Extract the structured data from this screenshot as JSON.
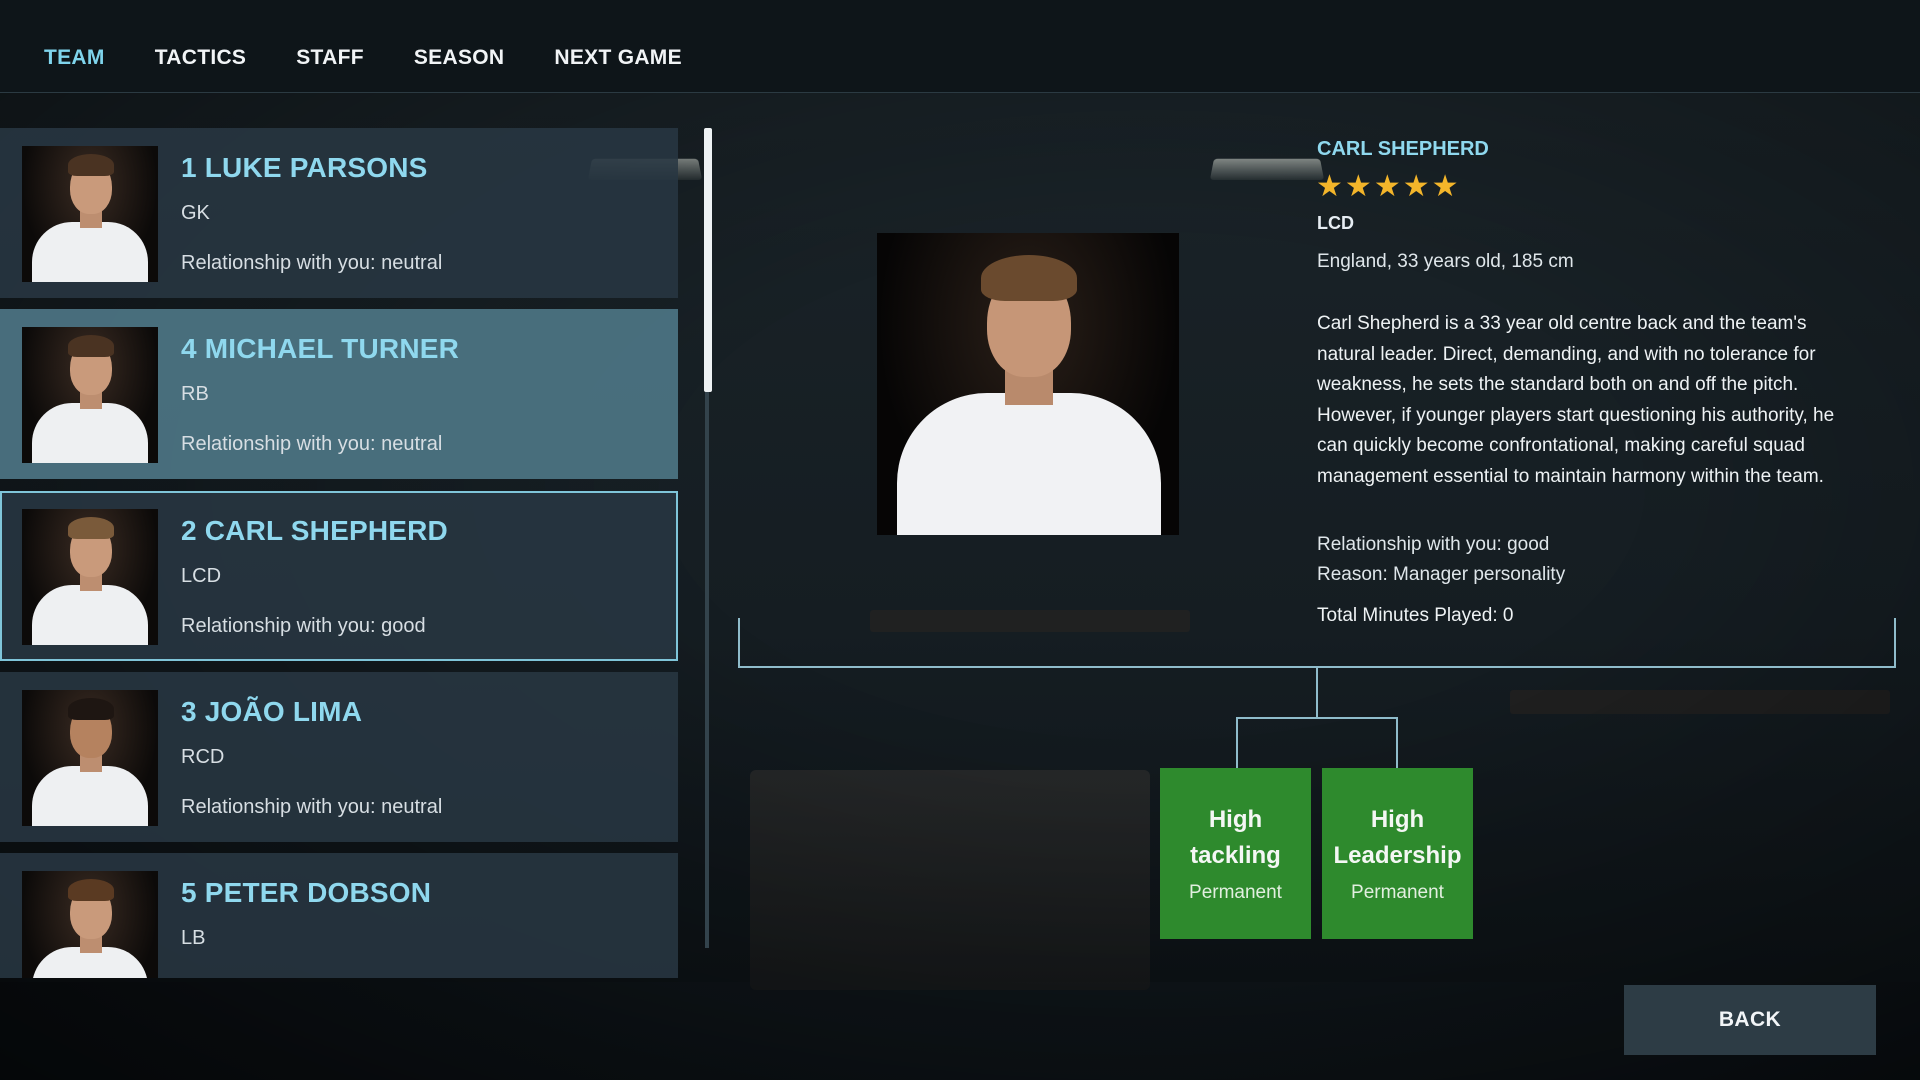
{
  "nav": {
    "items": [
      {
        "label": "TEAM",
        "active": true
      },
      {
        "label": "TACTICS",
        "active": false
      },
      {
        "label": "STAFF",
        "active": false
      },
      {
        "label": "SEASON",
        "active": false
      },
      {
        "label": "NEXT GAME",
        "active": false
      }
    ]
  },
  "players": [
    {
      "name": "1 LUKE PARSONS",
      "position": "GK",
      "relationship": "Relationship with you: neutral",
      "state": "normal"
    },
    {
      "name": "4 MICHAEL TURNER",
      "position": "RB",
      "relationship": "Relationship with you: neutral",
      "state": "hover"
    },
    {
      "name": "2 CARL SHEPHERD",
      "position": "LCD",
      "relationship": "Relationship with you: good",
      "state": "selected"
    },
    {
      "name": "3 JOÃO LIMA",
      "position": "RCD",
      "relationship": "Relationship with you: neutral",
      "state": "normal"
    },
    {
      "name": "5 PETER DOBSON",
      "position": "LB",
      "relationship": "",
      "state": "normal"
    }
  ],
  "detail": {
    "name": "CARL SHEPHERD",
    "rating": 5,
    "position": "LCD",
    "info": "England, 33 years old, 185 cm",
    "bio": "Carl Shepherd is a 33 year old centre back and the team's natural leader. Direct, demanding, and with no tolerance for weakness, he sets the standard both on and off the pitch. However, if younger players start questioning his authority, he can quickly become confrontational, making careful squad management essential to maintain harmony within the team.",
    "relationship": "Relationship with you: good",
    "reason": "Reason: Manager personality",
    "minutes": "Total Minutes Played: 0"
  },
  "traits": [
    {
      "title_line1": "High",
      "title_line2": "tackling",
      "duration": "Permanent"
    },
    {
      "title_line1": "High",
      "title_line2": "Leadership",
      "duration": "Permanent"
    }
  ],
  "back_label": "BACK",
  "colors": {
    "accent": "#8fd8ee",
    "trait": "#2e8a2d",
    "star": "#f3b52a",
    "card": "#28374a",
    "card_hover": "#4d7584"
  }
}
